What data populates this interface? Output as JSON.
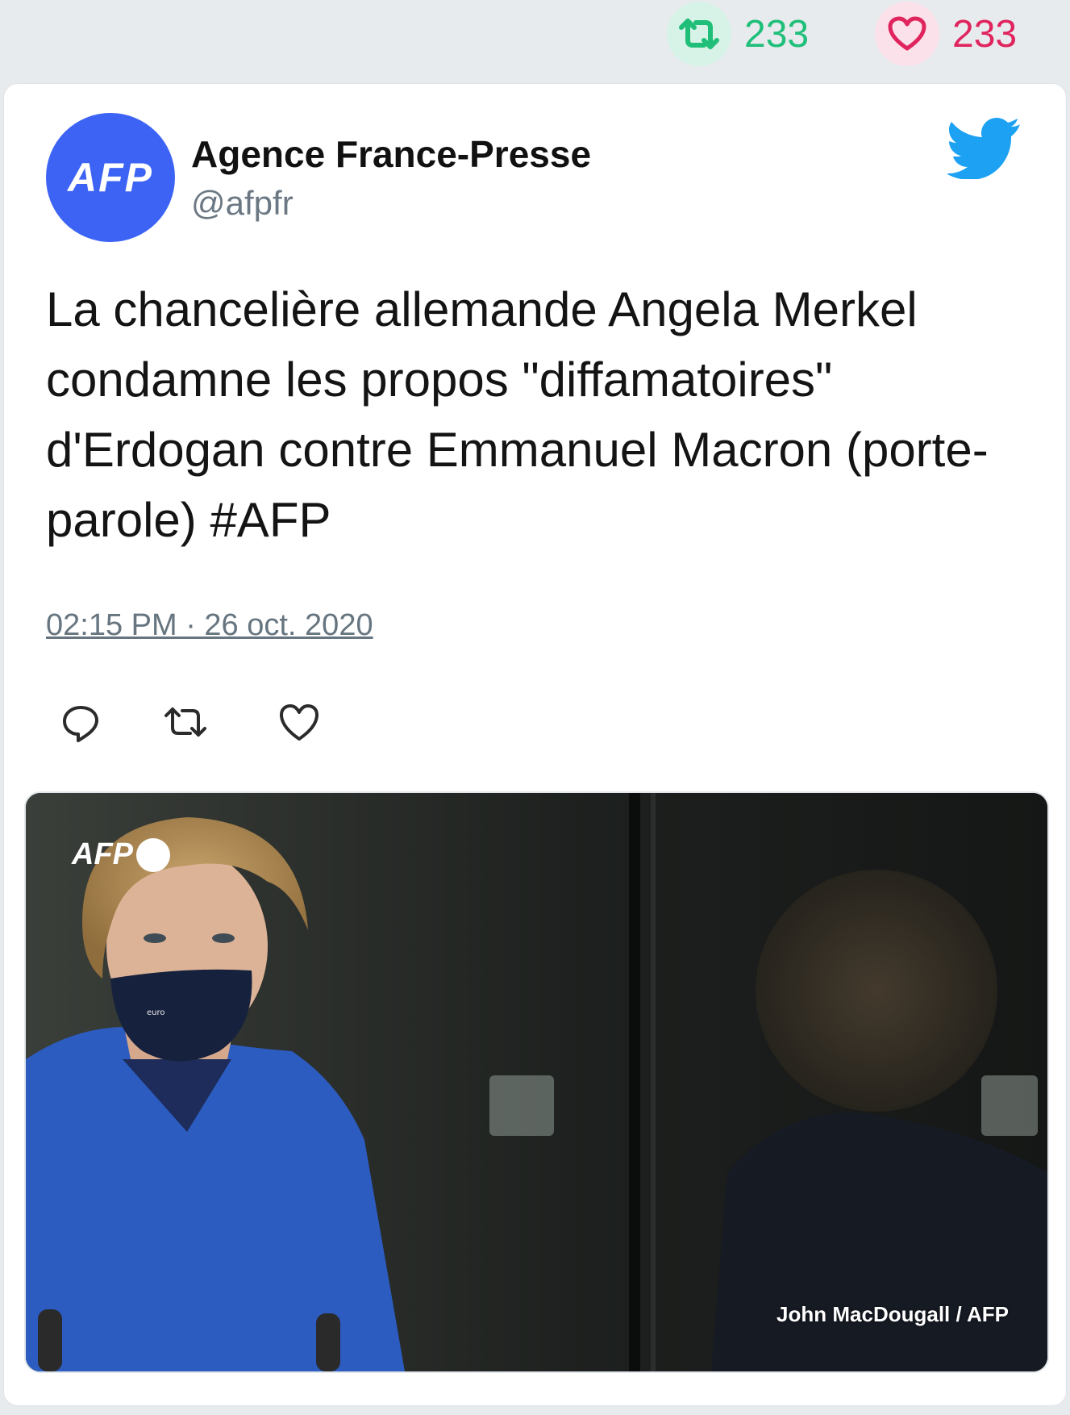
{
  "stats": {
    "retweets": "233",
    "likes": "233"
  },
  "tweet": {
    "author_name": "Agence France-Presse",
    "author_handle": "@afpfr",
    "avatar_text": "AFP",
    "text": "La chancelière allemande Angela Merkel condamne les propos \"diffamatoires\" d'Erdogan contre Emmanuel Macron (porte-parole) #AFP",
    "timestamp": "02:15 PM · 26 oct. 2020"
  },
  "media": {
    "watermark": "AFP",
    "credit": "John MacDougall / AFP"
  },
  "icons": {
    "retweet": "retweet-icon",
    "like": "heart-icon",
    "reply": "reply-icon",
    "brand": "twitter-bird-icon"
  },
  "colors": {
    "retweet": "#1fbf79",
    "like": "#e0245e",
    "brand": "#1da1f2",
    "avatar": "#3d63f5"
  }
}
